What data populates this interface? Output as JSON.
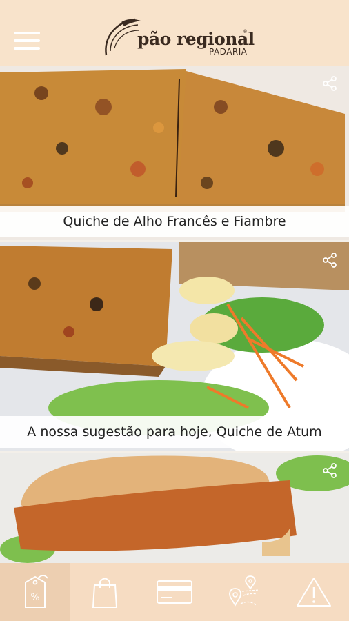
{
  "app": {
    "logo_name": "pão regional",
    "logo_sub": "PADARIA",
    "logo_reg": "®"
  },
  "header": {
    "menu_icon": "hamburger-menu-icon"
  },
  "feed": [
    {
      "caption": "Quiche de Alho Francês e Fiambre",
      "share_icon": "share-icon"
    },
    {
      "caption": "A nossa sugestão para hoje, Quiche de Atum",
      "share_icon": "share-icon"
    },
    {
      "caption": "",
      "share_icon": "share-icon"
    }
  ],
  "tabbar": {
    "items": [
      {
        "icon": "discount-tag-icon",
        "active": true
      },
      {
        "icon": "shopping-bag-icon",
        "active": false
      },
      {
        "icon": "card-icon",
        "active": false
      },
      {
        "icon": "map-location-icon",
        "active": false
      },
      {
        "icon": "warning-icon",
        "active": false
      }
    ]
  },
  "colors": {
    "header_bg": "#f8e3cb",
    "tabbar_bg": "#f6dcc2",
    "tab_active_bg": "#edcfb1",
    "icon_white": "#ffffff"
  }
}
